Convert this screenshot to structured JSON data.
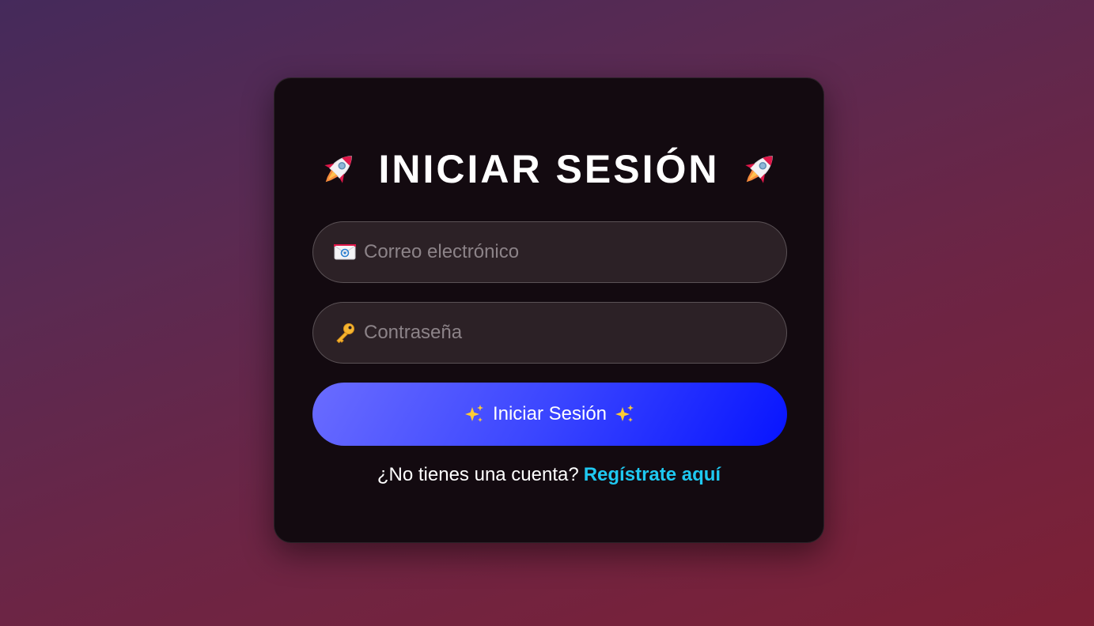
{
  "login": {
    "title": "INICIAR SESIÓN",
    "title_icon": "rocket-icon",
    "email": {
      "placeholder": "Correo electrónico",
      "value": "",
      "icon": "envelope-icon"
    },
    "password": {
      "placeholder": "Contraseña",
      "value": "",
      "icon": "key-icon"
    },
    "submit_label": "Iniciar Sesión",
    "submit_icon": "sparkles-icon",
    "footer_text": "¿No tienes una cuenta?",
    "register_link": "Regístrate aquí"
  },
  "colors": {
    "card_background": "#130a10",
    "button_gradient_start": "#6a6cff",
    "button_gradient_end": "#0714ff",
    "link": "#1fc8f0",
    "text": "#ffffff"
  }
}
